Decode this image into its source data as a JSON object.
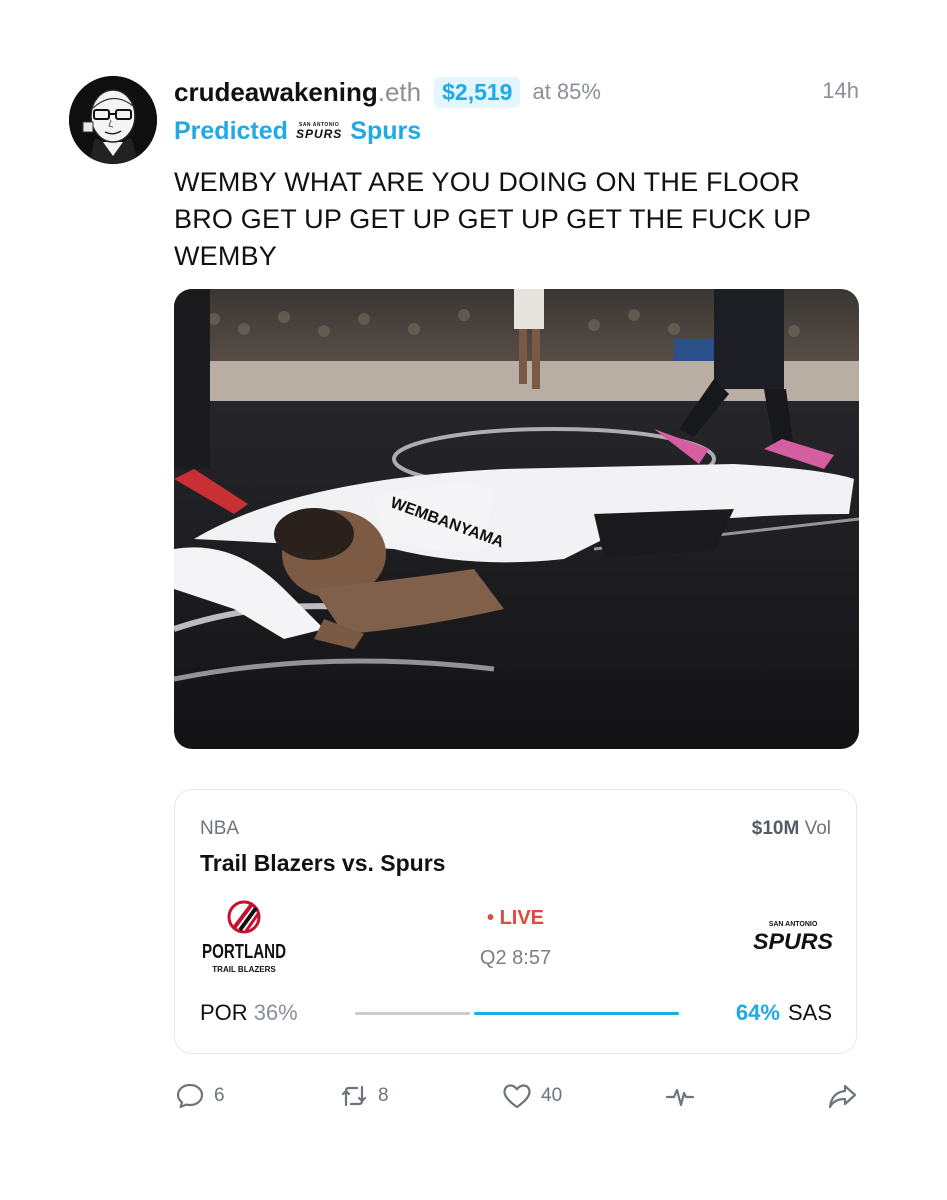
{
  "post": {
    "username": "crudeawakening",
    "username_suffix": ".eth",
    "amount": "$2,519",
    "at_text": "at 85%",
    "time": "14h",
    "predicted_label": "Predicted",
    "predicted_team": "Spurs",
    "text": "WEMBY WHAT ARE YOU DOING ON THE FLOOR BRO GET UP GET UP GET UP GET THE FUCK UP WEMBY",
    "media_alt": "",
    "jersey_text": "WEMBANYAMA"
  },
  "market": {
    "league": "NBA",
    "volume_value": "$10M",
    "volume_label": "Vol",
    "matchup": "Trail Blazers vs. Spurs",
    "live_label": "LIVE",
    "clock": "Q2 8:57",
    "home": {
      "abbr": "POR",
      "pct": "36%",
      "logo_text": "PORTLAND",
      "logo_sub": "TRAIL BLAZERS",
      "value": 0.36
    },
    "away": {
      "abbr": "SAS",
      "pct": "64%",
      "logo_top": "SAN ANTONIO",
      "logo_text": "SPURS",
      "value": 0.64
    }
  },
  "actions": {
    "comments": "6",
    "reposts": "8",
    "likes": "40"
  },
  "colors": {
    "accent": "#1fa9e6",
    "live": "#e5483f",
    "muted": "#8a8f98"
  },
  "icons": [
    "comment-icon",
    "repost-icon",
    "heart-icon",
    "activity-icon",
    "share-icon"
  ]
}
